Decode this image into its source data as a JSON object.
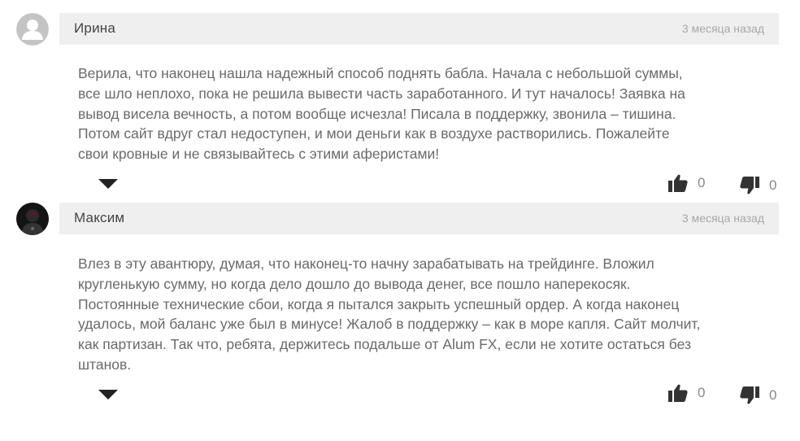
{
  "comments": [
    {
      "author": "Ирина",
      "date": "3 месяца назад",
      "avatar": "default-user-avatar",
      "lines": [
        "Верила, что наконец нашла надежный способ поднять бабла. Начала с небольшой суммы,",
        "все шло неплохо, пока не решила вывести часть заработанного. И тут началось! Заявка на",
        "вывод висела вечность, а потом вообще исчезла! Писала в поддержку, звонила – тишина.",
        "Потом сайт вдруг стал недоступен, и мои деньги как в воздухе растворились. Пожалейте",
        "свои кровные и не связывайтесь с этими аферистами!"
      ],
      "likes": "0",
      "dislikes": "0"
    },
    {
      "author": "Максим",
      "date": "3 месяца назад",
      "avatar": "photo-avatar",
      "lines": [
        "Влез в эту авантюру, думая, что наконец-то начну зарабатывать на трейдинге. Вложил",
        "кругленькую сумму, но когда дело дошло до вывода денег, все пошло наперекосяк.",
        "Постоянные технические сбои, когда я пытался закрыть успешный ордер. А когда наконец",
        "удалось, мой баланс уже был в минусе! Жалоб в поддержку – как в море капля. Сайт молчит,",
        "как партизан. Так что, ребята, держитесь подальше от Alum FX, если не хотите остаться без",
        "штанов."
      ],
      "likes": "0",
      "dislikes": "0"
    }
  ],
  "icons": {
    "like": "thumbs-up-icon",
    "dislike": "thumbs-down-icon",
    "toggle": "triangle-down-icon"
  },
  "colors": {
    "header_bg": "#efefef",
    "author": "#444444",
    "date": "#a8a8a8",
    "text": "#6a6a6a",
    "icon": "#333333"
  }
}
